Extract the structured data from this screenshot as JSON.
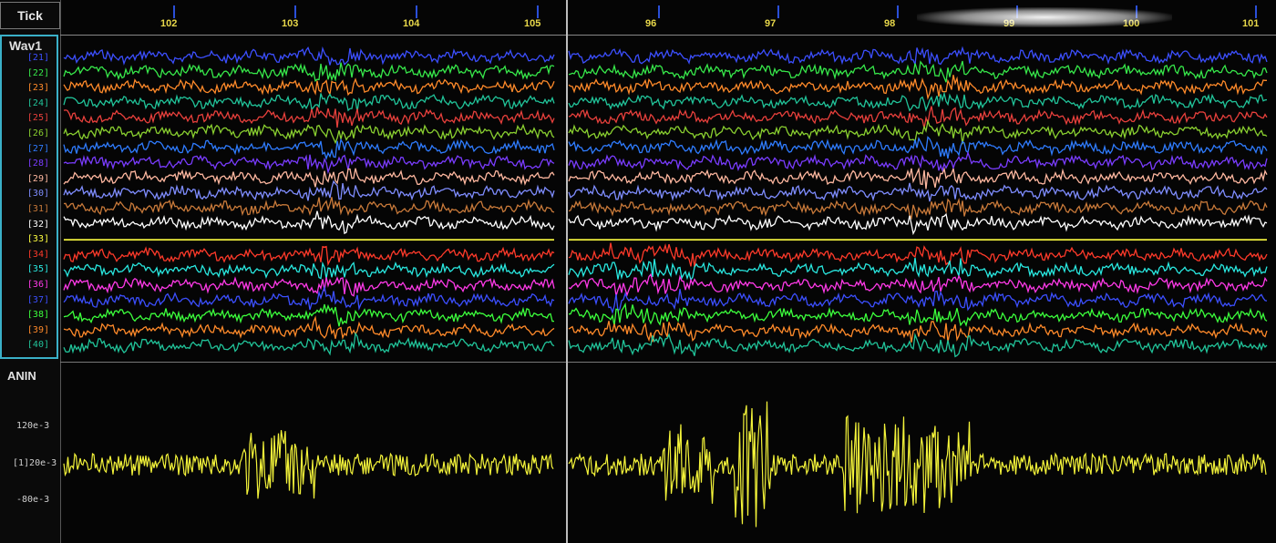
{
  "header": {
    "tick_label": "Tick"
  },
  "wav_group": {
    "title": "Wav1",
    "channels": [
      {
        "label": "[21]",
        "color": "#3c4fff"
      },
      {
        "label": "[22]",
        "color": "#37e84a"
      },
      {
        "label": "[23]",
        "color": "#ff8a2a"
      },
      {
        "label": "[24]",
        "color": "#21c49a"
      },
      {
        "label": "[25]",
        "color": "#e8403c"
      },
      {
        "label": "[26]",
        "color": "#8ad030"
      },
      {
        "label": "[27]",
        "color": "#2f7cff"
      },
      {
        "label": "[28]",
        "color": "#7a3cff"
      },
      {
        "label": "[29]",
        "color": "#ffb8a0"
      },
      {
        "label": "[30]",
        "color": "#7f8dff"
      },
      {
        "label": "[31]",
        "color": "#c97a3a"
      },
      {
        "label": "[32]",
        "color": "#ffffff"
      },
      {
        "label": "[33]",
        "color": "#ffff40"
      },
      {
        "label": "[34]",
        "color": "#ff3a2a"
      },
      {
        "label": "[35]",
        "color": "#29e8e0"
      },
      {
        "label": "[36]",
        "color": "#ff3ae8"
      },
      {
        "label": "[37]",
        "color": "#3c4fff"
      },
      {
        "label": "[38]",
        "color": "#3cff3c"
      },
      {
        "label": "[39]",
        "color": "#ff8a2a"
      },
      {
        "label": "[40]",
        "color": "#21c49a"
      }
    ]
  },
  "anin": {
    "title": "ANIN",
    "y_labels": [
      "120e-3",
      "[1]20e-3",
      "-80e-3"
    ],
    "color": "#f4f43a"
  },
  "ticks": {
    "left": [
      "102",
      "103",
      "104",
      "105"
    ],
    "right": [
      "96",
      "97",
      "98",
      "99",
      "100",
      "101"
    ],
    "color": "#e8d84a"
  }
}
